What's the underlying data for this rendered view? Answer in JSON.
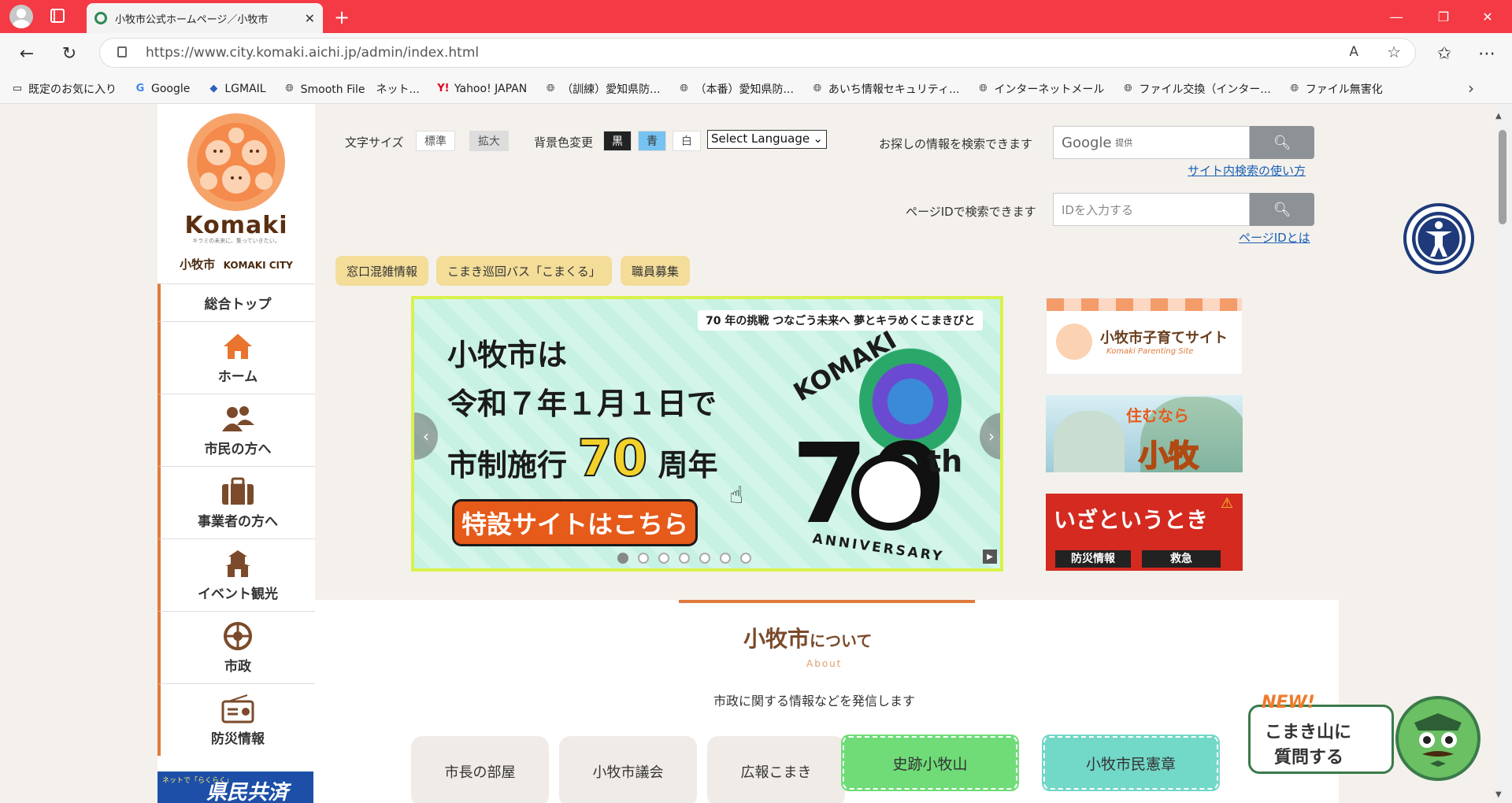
{
  "browser": {
    "tab_title": "小牧市公式ホームページ／小牧市",
    "url": "https://www.city.komaki.aichi.jp/admin/index.html",
    "bookmarks": [
      "既定のお気に入り",
      "Google",
      "LGMAIL",
      "Smooth File　ネット...",
      "Yahoo! JAPAN",
      "（訓練）愛知県防...",
      "（本番）愛知県防...",
      "あいち情報セキュリティ...",
      "インターネットメール",
      "ファイル交換（インター...",
      "ファイル無害化"
    ]
  },
  "site": {
    "logo_word": "Komaki",
    "logo_tagline": "キラミの未来に、集っていきたい。",
    "logo_city": "小牧市",
    "logo_city_en": "KOMAKI CITY",
    "nav_top": "総合トップ",
    "nav": [
      "ホーム",
      "市民の方へ",
      "事業者の方へ",
      "イベント観光",
      "市政",
      "防災情報"
    ],
    "bottom_banner": "県民共済",
    "bottom_banner_sub": "ネットで「らくらく」"
  },
  "header": {
    "font_size_label": "文字サイズ",
    "font_std": "標準",
    "font_big": "拡大",
    "bg_label": "背景色変更",
    "bg_black": "黒",
    "bg_blue": "青",
    "bg_white": "白",
    "language": "Select Language",
    "search_label": "お探しの情報を検索できます",
    "search_brand": "Google",
    "search_brand_sub": "提供",
    "search_help": "サイト内検索の使い方",
    "pageid_label": "ページIDで検索できます",
    "pageid_placeholder": "IDを入力する",
    "pageid_help": "ページIDとは",
    "pills": [
      "窓口混雑情報",
      "こまき巡回バス「こまくる」",
      "職員募集"
    ]
  },
  "carousel": {
    "tagline": "70 年の挑戦 つなごう未来へ 夢とキラめくこまきびと",
    "line1": "小牧市は",
    "line2": "令和７年１月１日で",
    "line3a": "市制施行",
    "line3b": "70",
    "line3c": "周年",
    "cta": "特設サイトはこちら",
    "logo_arc": "KOMAKI",
    "logo_num": "70",
    "logo_th": "th",
    "logo_anniv": "ANNIVERSARY",
    "dots": 7,
    "active_dot": 0
  },
  "side_banners": {
    "b1_title": "小牧市子育てサイト",
    "b1_sub": "Komaki Parenting Site",
    "b2_a": "住むなら",
    "b2_b": "小牧",
    "b3_title": "いざというとき",
    "b3_btn1": "防災情報",
    "b3_btn2": "救急"
  },
  "about": {
    "title": "小牧市",
    "title_suffix": "について",
    "subtitle": "About",
    "desc": "市政に関する情報などを発信します",
    "cards": [
      "市長の部屋",
      "小牧市議会",
      "広報こまき"
    ],
    "green_card": "史跡小牧山",
    "teal_card": "小牧市民憲章"
  },
  "chatbot": {
    "new": "NEW!",
    "text1": "こまき山に",
    "text2": "質問する"
  },
  "colors": {
    "accent": "#e07a3c",
    "tabbar": "#f43a44",
    "pill": "#f3dd98",
    "green": "#6fdc78",
    "teal": "#72d8c8"
  }
}
